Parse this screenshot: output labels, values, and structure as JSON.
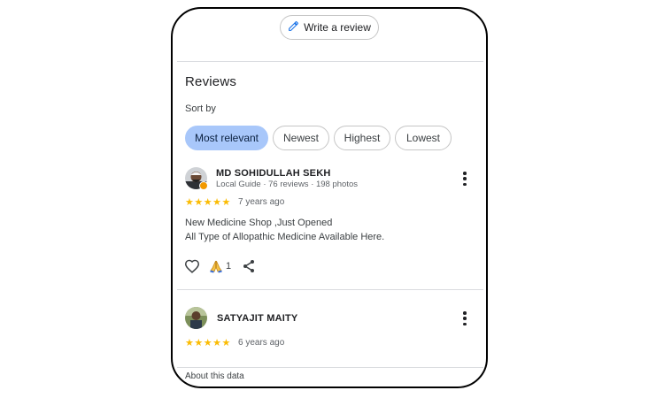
{
  "write_review": {
    "label": "Write a review",
    "icon": "pencil-icon"
  },
  "reviews": {
    "title": "Reviews",
    "sort_label": "Sort by",
    "chips": [
      "Most relevant",
      "Newest",
      "Highest",
      "Lowest"
    ],
    "items": [
      {
        "name": "MD SOHIDULLAH SEKH",
        "meta": "Local Guide · 76 reviews · 198 photos",
        "stars": "★★★★★",
        "rating": 5,
        "time": "7 years ago",
        "text_line1": "New Medicine Shop ,Just Opened",
        "text_line2": "All Type of Allopathic Medicine Available Here.",
        "reaction_count": "1"
      },
      {
        "name": "SATYAJIT MAITY",
        "stars": "★★★★★",
        "rating": 5,
        "time": "6 years ago"
      }
    ]
  },
  "footer": {
    "about": "About this data"
  },
  "colors": {
    "accent_chip": "#a8c7fa",
    "star": "#fbbc04",
    "badge": "#f29900"
  }
}
